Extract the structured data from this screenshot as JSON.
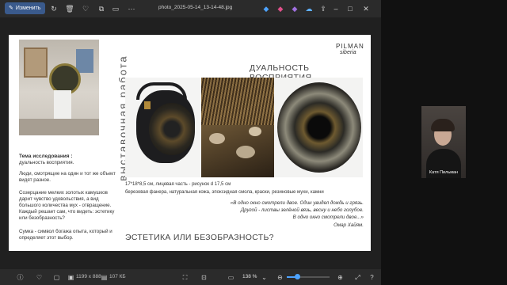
{
  "toolbar": {
    "edit_label": "Изменить",
    "file_name": "photo_2025-05-14_13-14-48.jpg"
  },
  "slide": {
    "brand_line1": "PILMAN",
    "brand_line2": "siberia",
    "vertical_title": "выставочная работа",
    "heading": "ДУАЛЬНОСТЬ ВОСПРИЯТИЯ",
    "research_title": "Тема исследования :",
    "research_subject": "дуальность восприятия.",
    "para1": "Люди, смотрящие на один и тот же объект видят разное.",
    "para2": "Созерцание мелких золотых камушков дарит чувство удовольствия, а вид большого количества мух - отвращение. Каждый решает сам, что видеть: эстетику или безобразность?",
    "para3": "Сумка - символ богажа опыта, который и определяет этот выбор.",
    "size_line": "17*18*8,5 см, лицевая часть - рисунок d 17,5 см",
    "materials": "березовая фанера, натуральная кожа, эпоксидная смола, краски, резиновые мухи, камни",
    "quote_line1": "«В одно окно смотрели двое. Один увидел дождь и грязь.",
    "quote_line2": "Другой - листвы зелёной вязь, весну и небо голубое.",
    "quote_line3": "В одно окно смотрели двое...»",
    "quote_author": "Омар Хайям.",
    "bottom_question": "ЭСТЕТИКА ИЛИ БЕЗОБРАЗНОСТЬ?"
  },
  "status": {
    "dimensions": "1199 x 888",
    "file_size": "107 КБ",
    "zoom": "138 %"
  },
  "participant": {
    "name": "Катя Пильман"
  }
}
